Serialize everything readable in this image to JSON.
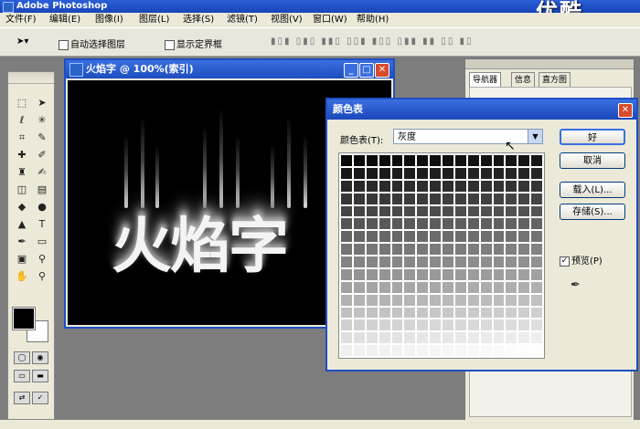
{
  "app": {
    "title": "Adobe Photoshop",
    "watermark": "优酷"
  },
  "menu": {
    "items": [
      "文件(F)",
      "编辑(E)",
      "图像(I)",
      "图层(L)",
      "选择(S)",
      "滤镜(T)",
      "视图(V)",
      "窗口(W)",
      "帮助(H)"
    ]
  },
  "options": {
    "tool_icon": "move-tool-icon",
    "auto_select_layer": "自动选择图层",
    "show_bounding_box": "显示定界框"
  },
  "document": {
    "title": "火焰字 @ 100%(索引)",
    "canvas_text": "火焰字"
  },
  "panels": {
    "tabs": [
      "导航器",
      "信息",
      "直方图"
    ]
  },
  "dialog": {
    "title": "颜色表",
    "table_label": "颜色表(T):",
    "table_value": "灰度",
    "ok_label": "好",
    "cancel_label": "取消",
    "load_label": "载入(L)...",
    "save_label": "存储(S)...",
    "preview_label": "预览(P)",
    "preview_checked": true
  }
}
